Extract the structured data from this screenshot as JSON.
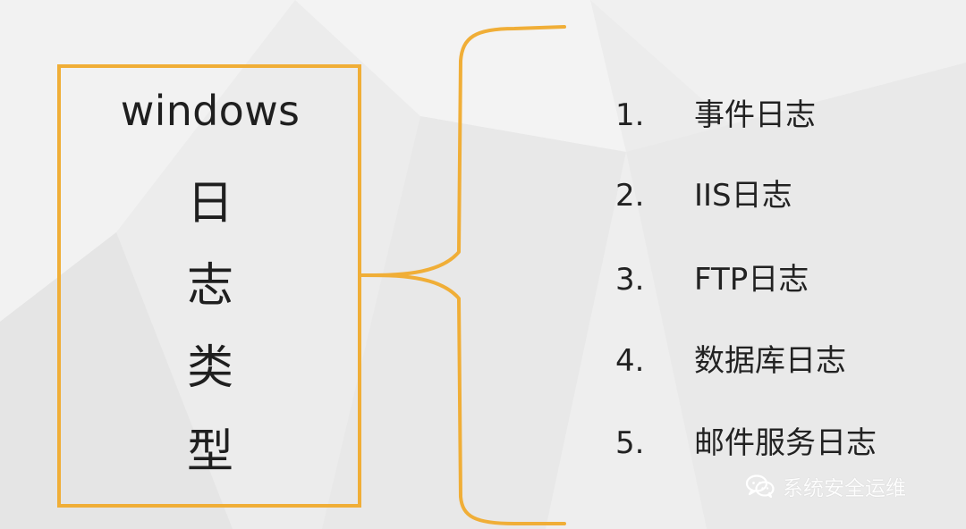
{
  "diagram": {
    "left_title": "windows",
    "left_chars": [
      "日",
      "志",
      "类",
      "型"
    ],
    "items": [
      {
        "number": "1.",
        "text": "事件日志"
      },
      {
        "number": "2.",
        "text": "IIS日志"
      },
      {
        "number": "3.",
        "text": "FTP日志"
      },
      {
        "number": "4.",
        "text": "数据库日志"
      },
      {
        "number": "5.",
        "text": "邮件服务日志"
      }
    ],
    "colors": {
      "accent": "#f0ae37",
      "text": "#222222",
      "background": "#ededed"
    }
  },
  "watermark": {
    "icon": "wechat-icon",
    "text": "系统安全运维"
  }
}
